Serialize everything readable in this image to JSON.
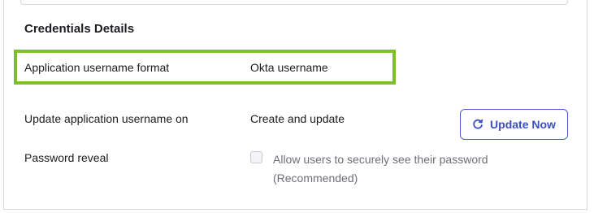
{
  "section": {
    "title": "Credentials Details"
  },
  "rows": {
    "username_format": {
      "label": "Application username format",
      "value": "Okta username"
    },
    "update_on": {
      "label": "Update application username on",
      "value": "Create and update"
    },
    "password_reveal": {
      "label": "Password reveal",
      "checkbox_text": "Allow users to securely see their password (Recommended)",
      "checked": false
    }
  },
  "buttons": {
    "update_now": {
      "label": "Update Now",
      "icon": "refresh-icon"
    }
  },
  "colors": {
    "highlight_border": "#7dbf2c",
    "button_accent": "#3a4fc1"
  }
}
